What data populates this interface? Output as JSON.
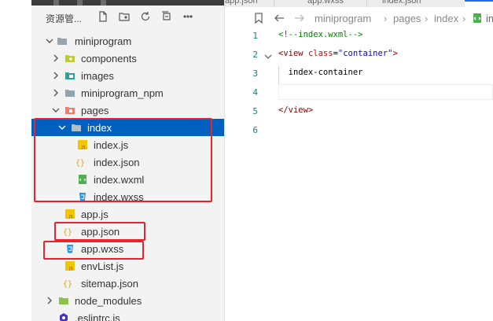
{
  "explorer": {
    "title": "资源管...",
    "tools": [
      "new-file-icon",
      "new-folder-icon",
      "refresh-icon",
      "collapse-all-icon",
      "more-icon"
    ]
  },
  "tree": [
    {
      "label": "miniprogram",
      "kind": "folder-open",
      "expanded": true
    },
    {
      "label": "components",
      "kind": "components-folder",
      "expanded": false
    },
    {
      "label": "images",
      "kind": "images-folder",
      "expanded": false
    },
    {
      "label": "miniprogram_npm",
      "kind": "folder",
      "expanded": false
    },
    {
      "label": "pages",
      "kind": "pages-folder",
      "expanded": true
    },
    {
      "label": "index",
      "kind": "folder-open",
      "expanded": true,
      "selected": true
    },
    {
      "label": "index.js",
      "kind": "js-file"
    },
    {
      "label": "index.json",
      "kind": "json-file"
    },
    {
      "label": "index.wxml",
      "kind": "wxml-file"
    },
    {
      "label": "index.wxss",
      "kind": "wxss-file"
    },
    {
      "label": "app.js",
      "kind": "js-file"
    },
    {
      "label": "app.json",
      "kind": "json-file"
    },
    {
      "label": "app.wxss",
      "kind": "wxss-file"
    },
    {
      "label": "envList.js",
      "kind": "js-file"
    },
    {
      "label": "sitemap.json",
      "kind": "json-file"
    },
    {
      "label": "node_modules",
      "kind": "node-folder",
      "expanded": false
    },
    {
      "label": ".eslintrc.js",
      "kind": "eslint-file"
    }
  ],
  "tabs": [
    "app.json",
    "app.wxss",
    "index.json"
  ],
  "breadcrumbs": {
    "items": [
      "miniprogram",
      "pages",
      "index"
    ],
    "trailing": "in"
  },
  "editor": {
    "lines": [
      {
        "no": "1",
        "tokens": [
          {
            "t": "<!--index.wxml-->",
            "c": "c-comment"
          }
        ]
      },
      {
        "no": "2",
        "fold": true,
        "tokens": [
          {
            "t": "<",
            "c": "c-punc"
          },
          {
            "t": "view",
            "c": "c-tag"
          },
          {
            "t": " class",
            "c": "c-attr"
          },
          {
            "t": "=",
            "c": "c-text"
          },
          {
            "t": "\"container\"",
            "c": "c-str"
          },
          {
            "t": ">",
            "c": "c-punc"
          }
        ]
      },
      {
        "no": "3",
        "tokens": [
          {
            "t": "  index-container",
            "c": "c-text"
          }
        ]
      },
      {
        "no": "4",
        "tokens": []
      },
      {
        "no": "5",
        "tokens": [
          {
            "t": "</",
            "c": "c-punc"
          },
          {
            "t": "view",
            "c": "c-tag"
          },
          {
            "t": ">",
            "c": "c-punc"
          }
        ]
      },
      {
        "no": "6",
        "tokens": []
      }
    ]
  },
  "colors": {
    "selection": "#0060c0",
    "highlight_box": "#e8242a",
    "explorer_bg": "#f3f3f3"
  }
}
